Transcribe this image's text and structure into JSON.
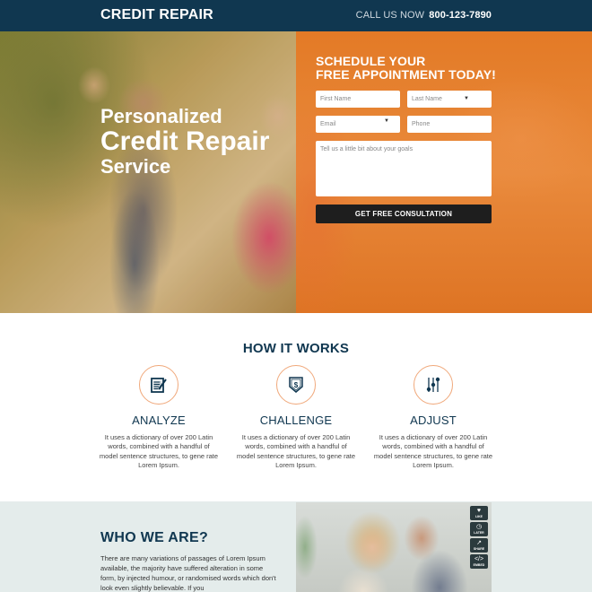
{
  "header": {
    "logo": "CREDIT REPAIR",
    "call_label": "CALL US NOW",
    "phone": "800-123-7890"
  },
  "hero": {
    "headline_line1": "Personalized",
    "headline_line2": "Credit Repair",
    "headline_line3": "Service",
    "form": {
      "title_line1": "SCHEDULE YOUR",
      "title_line2": "FREE APPOINTMENT TODAY!",
      "first_name_placeholder": "First Name",
      "last_name_placeholder": "Last Name",
      "email_placeholder": "Email",
      "phone_placeholder": "Phone",
      "goals_placeholder": "Tell us a little bit about your goals",
      "submit_label": "GET FREE CONSULTATION"
    }
  },
  "how_it_works": {
    "title": "HOW IT WORKS",
    "steps": [
      {
        "icon": "document-edit-icon",
        "title": "ANALYZE",
        "text": "It uses a dictionary of over 200 Latin words, combined with a handful of model sentence structures, to gene rate Lorem Ipsum."
      },
      {
        "icon": "dollar-shield-icon",
        "title": "CHALLENGE",
        "text": "It uses a dictionary of over 200 Latin words, combined with a handful of model sentence structures, to gene rate Lorem Ipsum."
      },
      {
        "icon": "sliders-icon",
        "title": "ADJUST",
        "text": "It uses a dictionary of over 200 Latin words, combined with a handful of model sentence structures, to gene rate Lorem Ipsum."
      }
    ]
  },
  "who_we_are": {
    "title": "WHO WE ARE?",
    "text": "There are many variations of passages of Lorem Ipsum available, the majority have suffered alteration in some form, by injected humour, or randomised words which don't look even slightly believable. If you",
    "share_buttons": [
      {
        "icon": "heart-icon",
        "label": "LIKE"
      },
      {
        "icon": "clock-icon",
        "label": "LATER"
      },
      {
        "icon": "share-icon",
        "label": "SHARE"
      },
      {
        "icon": "embed-icon",
        "label": "EMBED"
      }
    ]
  },
  "colors": {
    "navy": "#103750",
    "orange": "#e37a26",
    "button_dark": "#1e1e1e",
    "section_bg": "#e4eceb",
    "circle_border": "#f0a87a"
  }
}
